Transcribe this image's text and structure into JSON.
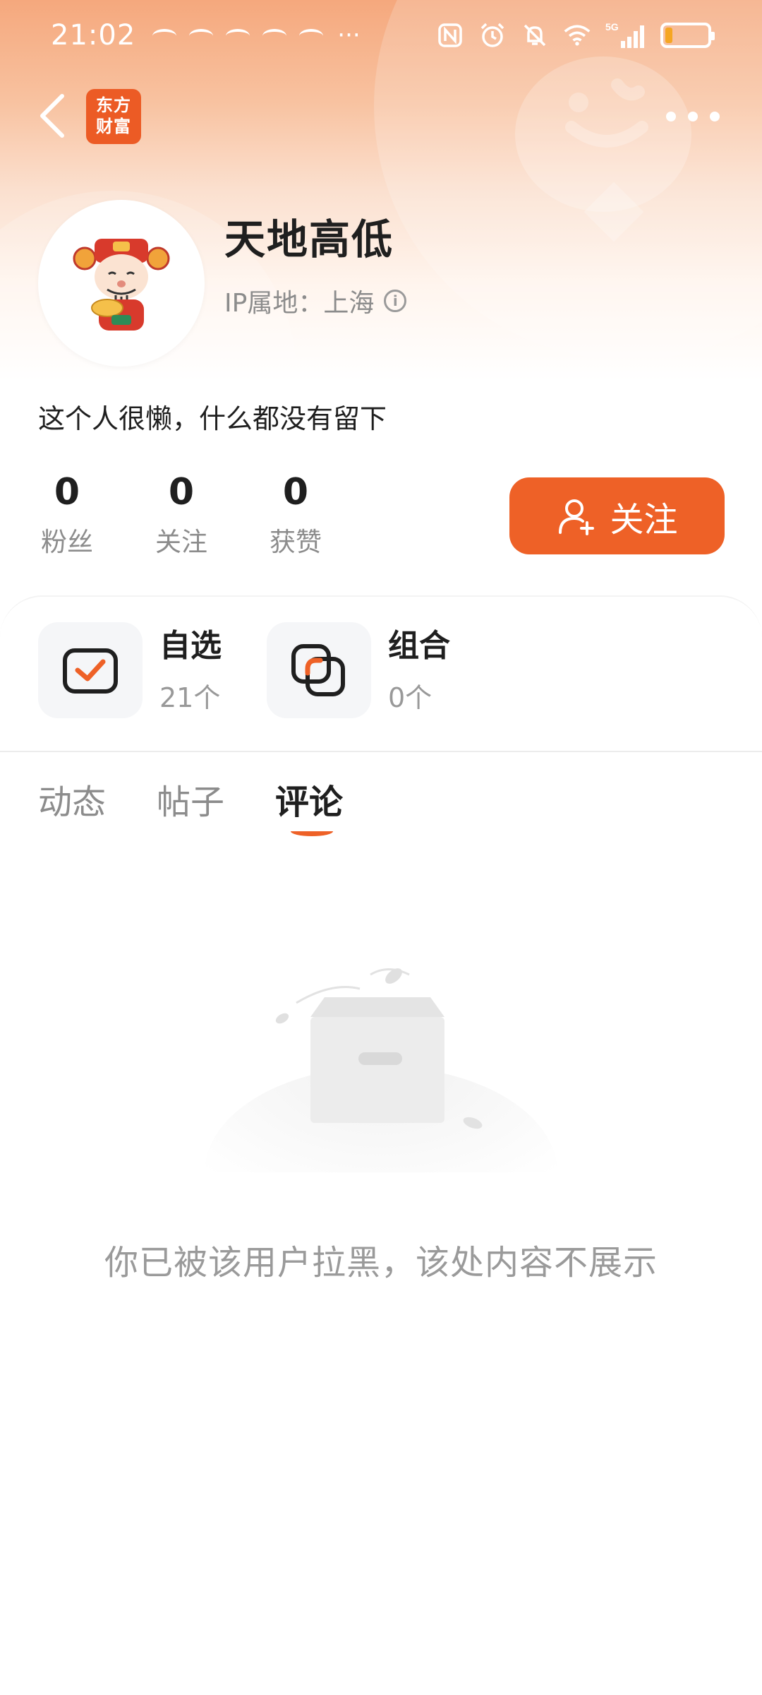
{
  "status_bar": {
    "time": "21:02",
    "more": "···",
    "network": "5G",
    "battery_level": 0.18,
    "battery_color": "#f5a623"
  },
  "nav": {
    "back_icon": "chevron-left-icon",
    "logo_text": [
      "东方",
      "财富"
    ],
    "more_icon": "more-dots-icon"
  },
  "profile": {
    "username": "天地高低",
    "ip_location": "IP属地：上海",
    "bio": "这个人很懒，什么都没有留下",
    "stats": [
      {
        "value": "0",
        "label": "粉丝"
      },
      {
        "value": "0",
        "label": "关注"
      },
      {
        "value": "0",
        "label": "获赞"
      }
    ],
    "follow_label": "关注"
  },
  "cards": [
    {
      "title": "自选",
      "count": "21个",
      "icon": "watchlist-icon"
    },
    {
      "title": "组合",
      "count": "0个",
      "icon": "portfolio-icon"
    }
  ],
  "tabs": [
    {
      "label": "动态",
      "active": false
    },
    {
      "label": "帖子",
      "active": false
    },
    {
      "label": "评论",
      "active": true
    }
  ],
  "empty_state": {
    "message": "你已被该用户拉黑，该处内容不展示",
    "icon": "empty-box-icon"
  },
  "colors": {
    "accent": "#ee6127",
    "brand_logo": "#ec5b25"
  }
}
